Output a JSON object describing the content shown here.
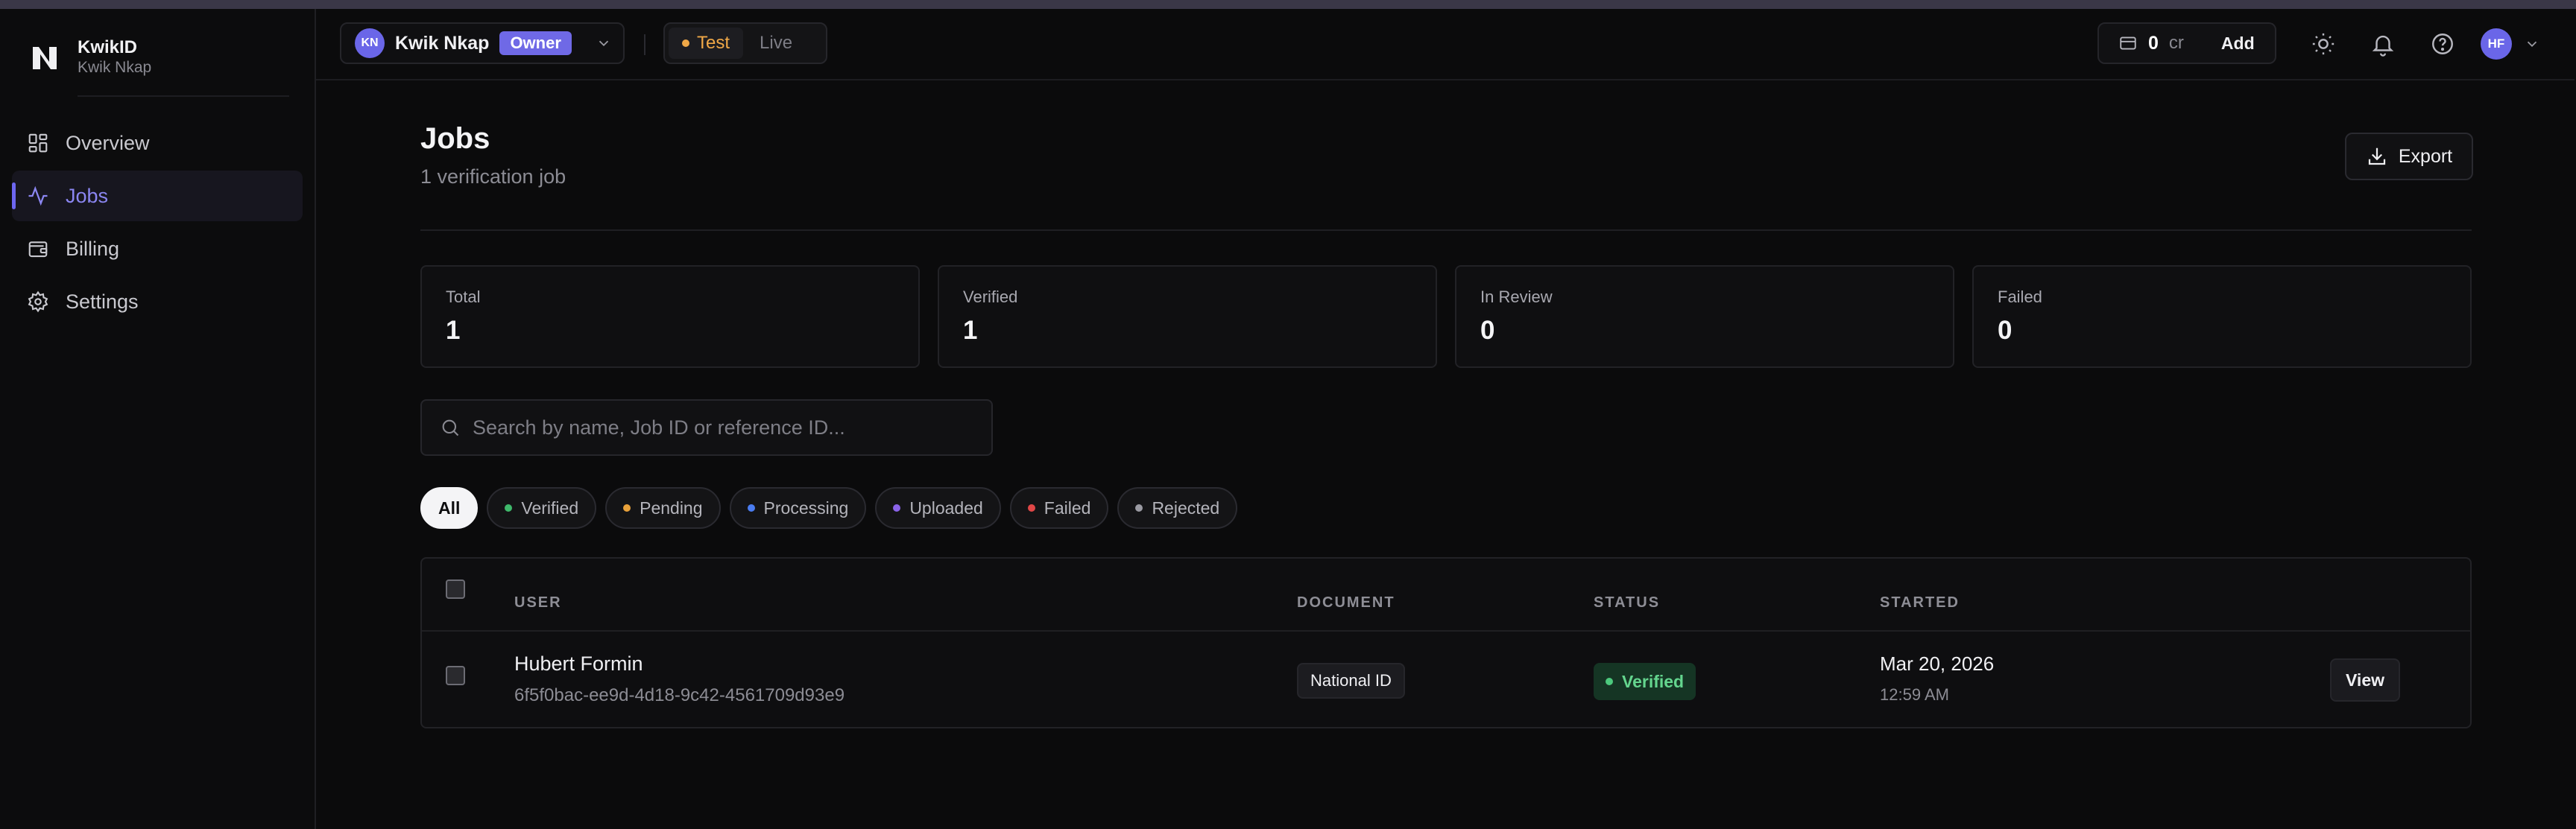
{
  "brand": {
    "name": "KwikID",
    "sub": "Kwik Nkap"
  },
  "sidebar": {
    "items": [
      {
        "label": "Overview",
        "icon": "grid-icon"
      },
      {
        "label": "Jobs",
        "icon": "activity-icon",
        "active": true
      },
      {
        "label": "Billing",
        "icon": "wallet-icon"
      },
      {
        "label": "Settings",
        "icon": "gear-icon"
      }
    ]
  },
  "header": {
    "org": {
      "initials": "KN",
      "name": "Kwik Nkap",
      "role": "Owner"
    },
    "modes": [
      {
        "label": "Test",
        "active": true
      },
      {
        "label": "Live",
        "active": false
      }
    ],
    "credits": {
      "value": "0",
      "unit": "cr",
      "add_label": "Add"
    },
    "user_initials": "HF"
  },
  "page": {
    "title": "Jobs",
    "subtitle": "1 verification job",
    "export_label": "Export"
  },
  "stats": [
    {
      "label": "Total",
      "value": "1"
    },
    {
      "label": "Verified",
      "value": "1"
    },
    {
      "label": "In Review",
      "value": "0"
    },
    {
      "label": "Failed",
      "value": "0"
    }
  ],
  "search": {
    "placeholder": "Search by name, Job ID or reference ID..."
  },
  "filters": [
    {
      "label": "All",
      "active": true
    },
    {
      "label": "Verified",
      "color": "#3fb96b"
    },
    {
      "label": "Pending",
      "color": "#e8a13a"
    },
    {
      "label": "Processing",
      "color": "#4a7cf0"
    },
    {
      "label": "Uploaded",
      "color": "#8a63e8"
    },
    {
      "label": "Failed",
      "color": "#e04747"
    },
    {
      "label": "Rejected",
      "color": "#9a9aa2"
    }
  ],
  "table": {
    "headers": {
      "user": "USER",
      "document": "DOCUMENT",
      "status": "STATUS",
      "started": "STARTED"
    },
    "rows": [
      {
        "name": "Hubert Formin",
        "id": "6f5f0bac-ee9d-4d18-9c42-4561709d93e9",
        "document": "National ID",
        "status": "Verified",
        "date": "Mar 20, 2026",
        "time": "12:59 AM",
        "action": "View"
      }
    ]
  },
  "colors": {
    "accent": "#6d66f0",
    "test_mode": "#f0a847",
    "verified": "#64d58e"
  }
}
